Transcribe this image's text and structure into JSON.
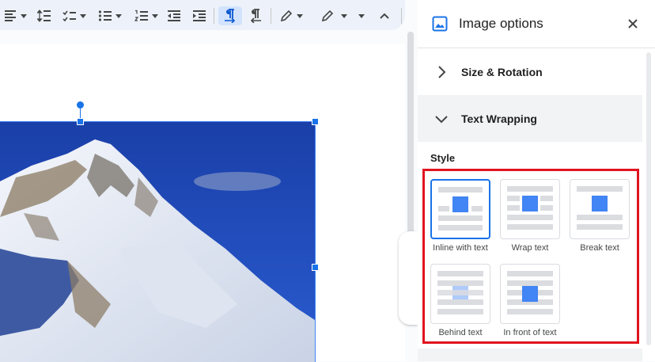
{
  "toolbar": {
    "tools": [
      "align-icon",
      "line-spacing-icon",
      "checklist-icon",
      "bulleted-list-icon",
      "numbered-list-icon",
      "decrease-indent-icon",
      "increase-indent-icon",
      "ltr-icon",
      "rtl-icon",
      "highlight-pen-icon",
      "pen-icon",
      "more-caret-icon",
      "collapse-icon"
    ],
    "active_tool": "ltr-icon"
  },
  "panel": {
    "title": "Image options",
    "sections": [
      {
        "label": "Size & Rotation",
        "expanded": false
      },
      {
        "label": "Text Wrapping",
        "expanded": true
      }
    ],
    "style_heading": "Style",
    "wrap_options": [
      {
        "label": "Inline with text",
        "selected": true
      },
      {
        "label": "Wrap text",
        "selected": false
      },
      {
        "label": "Break text",
        "selected": false
      },
      {
        "label": "Behind text",
        "selected": false
      },
      {
        "label": "In front of text",
        "selected": false
      }
    ]
  },
  "colors": {
    "accent": "#1a73e8",
    "highlight_box": "#e0131f",
    "toolbar_bg": "#edf2fa"
  }
}
